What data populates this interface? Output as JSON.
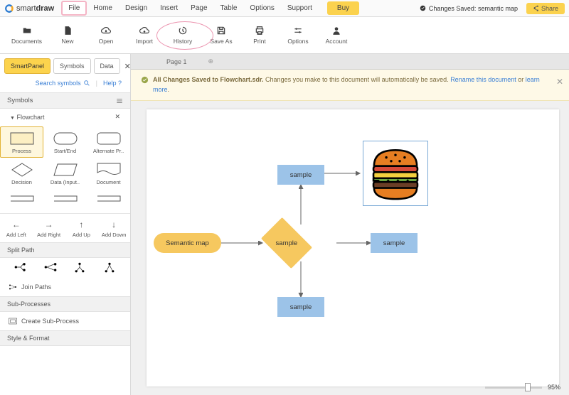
{
  "brand": {
    "text1": "smart",
    "text2": "draw"
  },
  "menu": [
    "File",
    "Home",
    "Design",
    "Insert",
    "Page",
    "Table",
    "Options",
    "Support"
  ],
  "buy": "Buy",
  "statusSaved": "Changes Saved: semantic map",
  "share": "Share",
  "toolbar": [
    {
      "id": "documents",
      "label": "Documents",
      "icon": "folder"
    },
    {
      "id": "new",
      "label": "New",
      "icon": "file"
    },
    {
      "id": "open",
      "label": "Open",
      "icon": "cloud-down"
    },
    {
      "id": "import",
      "label": "Import",
      "icon": "cloud-up"
    },
    {
      "id": "history",
      "label": "History",
      "icon": "history"
    },
    {
      "id": "saveas",
      "label": "Save As",
      "icon": "save"
    },
    {
      "id": "print",
      "label": "Print",
      "icon": "print"
    },
    {
      "id": "options",
      "label": "Options",
      "icon": "sliders"
    },
    {
      "id": "account",
      "label": "Account",
      "icon": "user"
    }
  ],
  "tabs": [
    "SmartPanel",
    "Symbols",
    "Data"
  ],
  "searchSymbols": "Search symbols",
  "help": "Help",
  "symbolsHead": "Symbols",
  "flowchartCat": "Flowchart",
  "shapes": [
    "Process",
    "Start/End",
    "Alternate Pr..",
    "Decision",
    "Data (Input..",
    "Document"
  ],
  "addBtns": [
    "Add Left",
    "Add Right",
    "Add Up",
    "Add Down"
  ],
  "splitHead": "Split Path",
  "joinPaths": "Join Paths",
  "subProcHead": "Sub-Processes",
  "createSub": "Create Sub-Process",
  "styleHead": "Style & Format",
  "pageTab": "Page 1",
  "banner": {
    "strong": "All Changes Saved to Flowchart.sdr.",
    "mid": " Changes you make to this document will automatically be saved. ",
    "rename": "Rename this document",
    "or": " or ",
    "learn": "learn more",
    "dot": "."
  },
  "nodes": {
    "start": "Semantic map",
    "center": "sample",
    "top": "sample",
    "right": "sample",
    "bottom": "sample"
  },
  "zoom": "95%"
}
